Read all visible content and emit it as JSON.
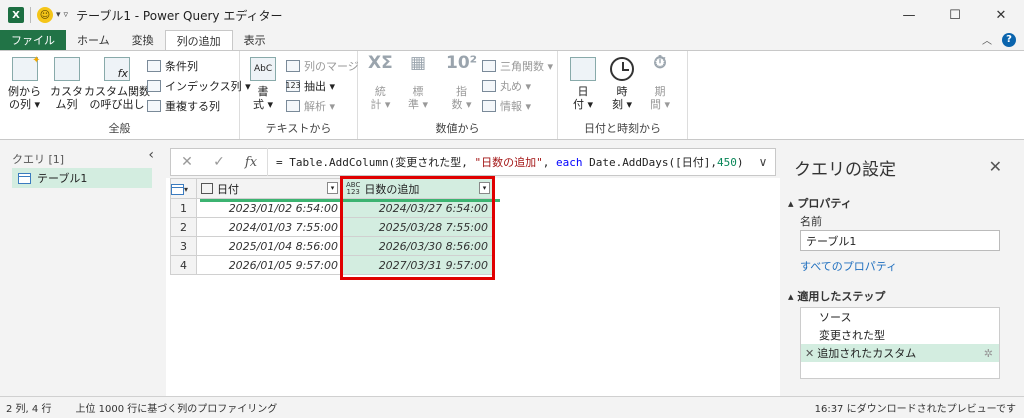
{
  "titlebar": {
    "title": "テーブル1 - Power Query エディター",
    "minimize": "—",
    "maximize": "☐",
    "close": "✕"
  },
  "tabs": [
    {
      "label": "ファイル"
    },
    {
      "label": "ホーム"
    },
    {
      "label": "変換"
    },
    {
      "label": "列の追加"
    },
    {
      "label": "表示"
    }
  ],
  "ribbon": {
    "general": {
      "label": "全般",
      "example_col": [
        "例から",
        "の列 ▾"
      ],
      "custom_col": [
        "カスタ",
        "ム列"
      ],
      "invoke_func": [
        "カスタム関数",
        "の呼び出し"
      ],
      "conditional": "条件列",
      "index": "インデックス列 ▾",
      "duplicate": "重複する列"
    },
    "text": {
      "label": "テキストから",
      "format": [
        "書",
        "式 ▾"
      ],
      "merge": "列のマージ",
      "extract": "抽出 ▾",
      "parse": "解析 ▾"
    },
    "number": {
      "label": "数値から",
      "stats": [
        "統",
        "計 ▾"
      ],
      "standard": [
        "標",
        "準 ▾"
      ],
      "scientific": [
        "指",
        "数 ▾"
      ],
      "trig": "三角関数 ▾",
      "rounding": "丸め ▾",
      "info": "情報 ▾"
    },
    "datetime": {
      "label": "日付と時刻から",
      "date": [
        "日",
        "付 ▾"
      ],
      "time": [
        "時",
        "刻 ▾"
      ],
      "duration": [
        "期",
        "間 ▾"
      ]
    }
  },
  "queries": {
    "header": "クエリ [1]",
    "items": [
      "テーブル1"
    ]
  },
  "formula": {
    "prefix": "= Table.AddColumn(変更された型, ",
    "str": "\"日数の追加\"",
    "mid": ", ",
    "kw": "each",
    "fn": " Date.AddDays([日付],",
    "num": "450",
    "end": ")"
  },
  "grid": {
    "col1": "日付",
    "col2": "日数の追加",
    "rows": [
      {
        "n": "1",
        "date": "2023/01/02 6:54:00",
        "added": "2024/03/27 6:54:00"
      },
      {
        "n": "2",
        "date": "2024/01/03 7:55:00",
        "added": "2025/03/28 7:55:00"
      },
      {
        "n": "3",
        "date": "2025/01/04 8:56:00",
        "added": "2026/03/30 8:56:00"
      },
      {
        "n": "4",
        "date": "2026/01/05 9:57:00",
        "added": "2027/03/31 9:57:00"
      }
    ]
  },
  "settings": {
    "title": "クエリの設定",
    "properties": "プロパティ",
    "name_label": "名前",
    "name_value": "テーブル1",
    "all_props": "すべてのプロパティ",
    "applied_steps": "適用したステップ",
    "steps": [
      "ソース",
      "変更された型",
      "追加されたカスタム"
    ]
  },
  "status": {
    "left1": "2 列, 4 行",
    "left2": "上位 1000 行に基づく列のプロファイリング",
    "right": "16:37 にダウンロードされたプレビューです"
  },
  "colors": {
    "excel_green": "#217346",
    "selection": "#d3ede0",
    "highlight": "#e00000"
  }
}
